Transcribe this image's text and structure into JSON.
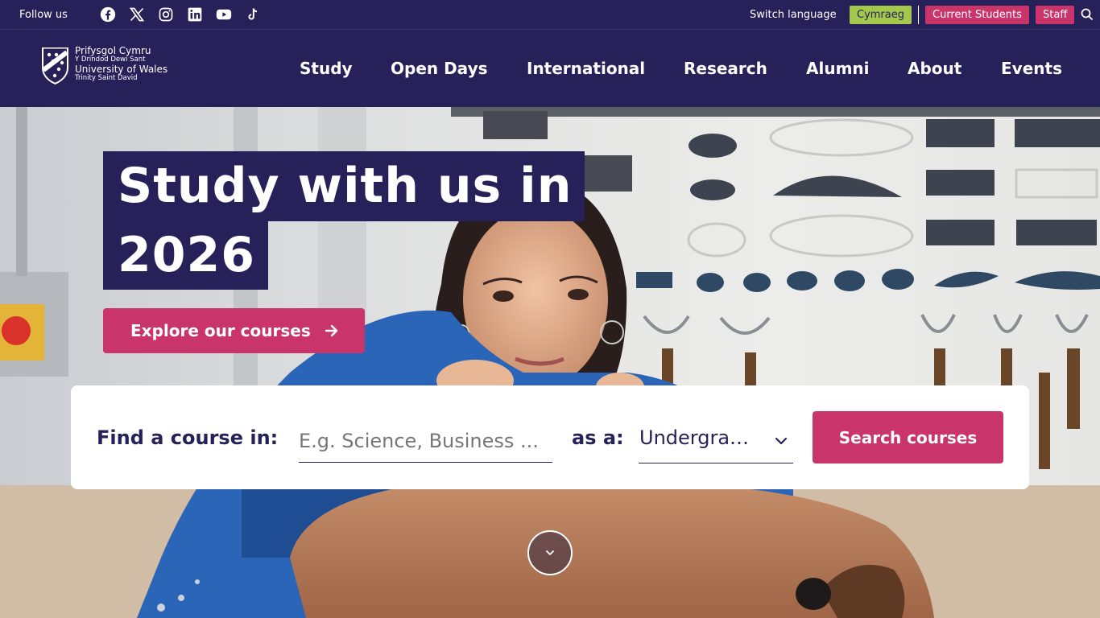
{
  "topbar": {
    "follow_label": "Follow us",
    "social": [
      "facebook-icon",
      "x-icon",
      "instagram-icon",
      "linkedin-icon",
      "youtube-icon",
      "tiktok-icon"
    ],
    "switch_language": "Switch language",
    "cymraeg": "Cymraeg",
    "current_students": "Current Students",
    "staff": "Staff"
  },
  "logo": {
    "line1": "Prifysgol Cymru",
    "line2": "Y Drindod Dewi Sant",
    "line3": "University of Wales",
    "line4": "Trinity Saint David"
  },
  "nav": [
    "Study",
    "Open Days",
    "International",
    "Research",
    "Alumni",
    "About",
    "Events"
  ],
  "hero": {
    "headline_line1": "Study with us in",
    "headline_line2": "2026",
    "explore_label": "Explore our courses"
  },
  "finder": {
    "label": "Find a course in:",
    "placeholder": "E.g. Science, Business ...",
    "as_label": "as a:",
    "level_value": "Undergraduate",
    "search_label": "Search courses"
  },
  "colors": {
    "primary": "#27215a",
    "accent": "#c9356a",
    "cymraeg": "#a3c84b"
  }
}
